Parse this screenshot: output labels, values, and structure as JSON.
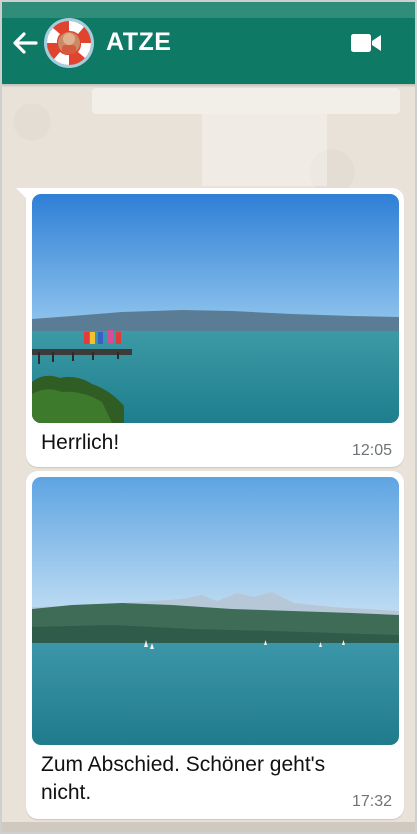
{
  "header": {
    "title": "ATZE",
    "back_icon": "arrow-left-icon",
    "video_icon": "video-camera-icon",
    "color": "#0e7a66"
  },
  "messages": [
    {
      "caption": "Herrlich!",
      "time": "12:05"
    },
    {
      "caption": "Zum Abschied. Schöner geht's nicht.",
      "time": "17:32"
    }
  ]
}
